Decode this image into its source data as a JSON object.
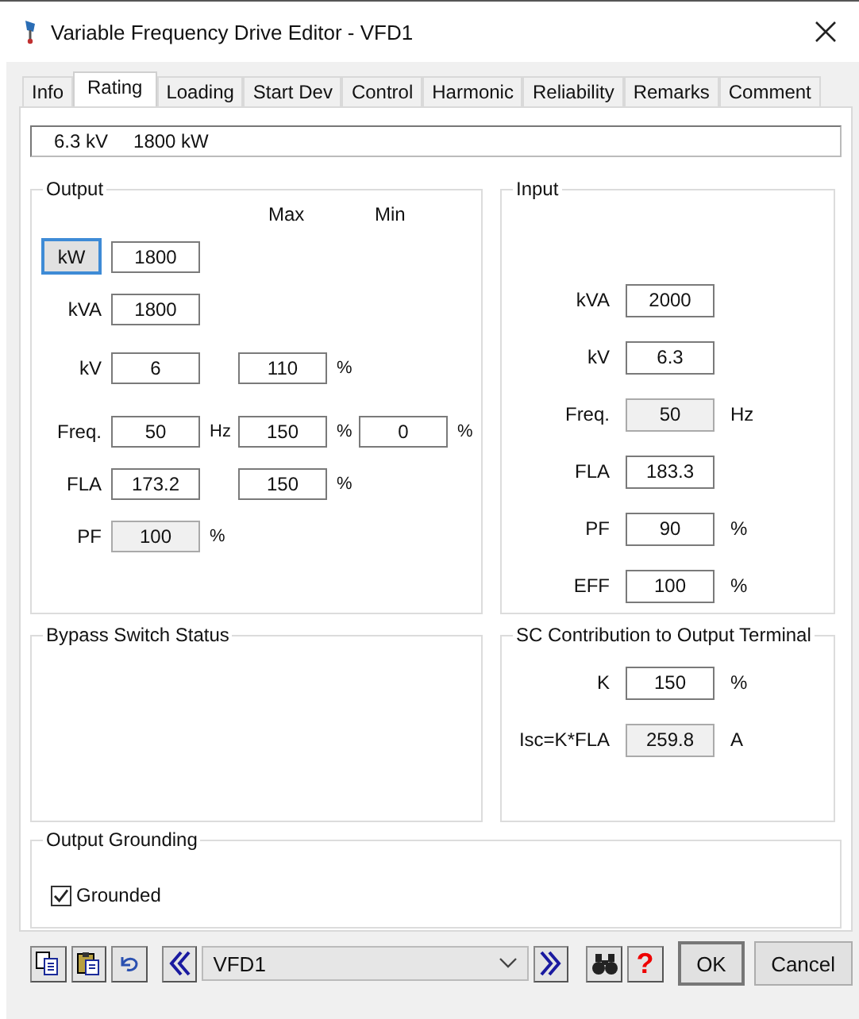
{
  "window": {
    "title": "Variable Frequency Drive Editor - VFD1"
  },
  "tabs": [
    {
      "label": "Info",
      "selected": false
    },
    {
      "label": "Rating",
      "selected": true
    },
    {
      "label": "Loading",
      "selected": false
    },
    {
      "label": "Start Dev",
      "selected": false
    },
    {
      "label": "Control",
      "selected": false
    },
    {
      "label": "Harmonic",
      "selected": false
    },
    {
      "label": "Reliability",
      "selected": false
    },
    {
      "label": "Remarks",
      "selected": false
    },
    {
      "label": "Comment",
      "selected": false
    }
  ],
  "summary": {
    "voltage": "6.3 kV",
    "power": "1800 kW"
  },
  "output": {
    "title": "Output",
    "col_max": "Max",
    "col_min": "Min",
    "rows": [
      {
        "kind": "button",
        "label": "kW",
        "value": "1800",
        "disabled": false
      },
      {
        "kind": "label",
        "label": "kVA",
        "value": "1800",
        "disabled": false
      },
      {
        "kind": "label",
        "label": "kV",
        "value": "6",
        "disabled": false,
        "max": "110",
        "max_unit": "%"
      },
      {
        "kind": "label",
        "label": "Freq.",
        "value": "50",
        "unit": "Hz",
        "disabled": false,
        "max": "150",
        "max_unit": "%",
        "min": "0",
        "min_unit": "%"
      },
      {
        "kind": "label",
        "label": "FLA",
        "value": "173.2",
        "disabled": false,
        "max": "150",
        "max_unit": "%"
      },
      {
        "kind": "label",
        "label": "PF",
        "value": "100",
        "unit": "%",
        "disabled": true
      }
    ]
  },
  "input": {
    "title": "Input",
    "rows": [
      {
        "label": "kVA",
        "value": "2000",
        "disabled": false
      },
      {
        "label": "kV",
        "value": "6.3",
        "disabled": false
      },
      {
        "label": "Freq.",
        "value": "50",
        "unit": "Hz",
        "disabled": true
      },
      {
        "label": "FLA",
        "value": "183.3",
        "disabled": false
      },
      {
        "label": "PF",
        "value": "90",
        "unit": "%",
        "disabled": false
      },
      {
        "label": "EFF",
        "value": "100",
        "unit": "%",
        "disabled": false
      }
    ]
  },
  "bypass": {
    "title": "Bypass Switch Status"
  },
  "sc_contribution": {
    "title": "SC Contribution to Output Terminal",
    "rows": [
      {
        "label": "K",
        "value": "150",
        "unit": "%",
        "disabled": false
      },
      {
        "label": "Isc=K*FLA",
        "value": "259.8",
        "unit": "A",
        "disabled": true
      }
    ]
  },
  "grounding": {
    "title": "Output Grounding",
    "checkbox": {
      "label": "Grounded",
      "checked": true
    }
  },
  "toolbar": {
    "record": "VFD1",
    "help": "?",
    "buttons": [
      "OK",
      "Cancel"
    ]
  }
}
